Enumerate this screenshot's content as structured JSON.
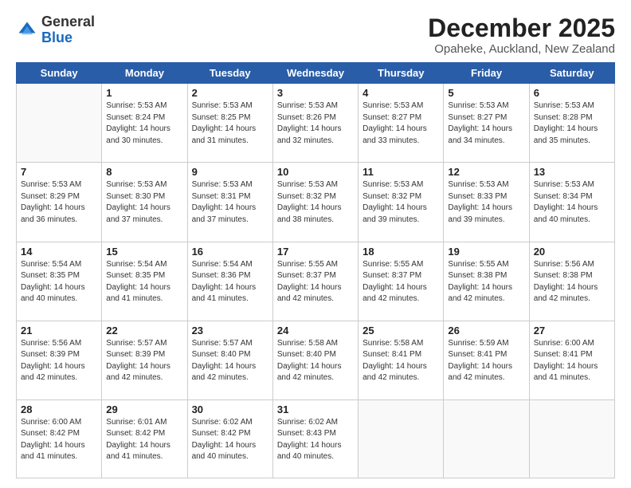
{
  "header": {
    "logo_general": "General",
    "logo_blue": "Blue",
    "month_title": "December 2025",
    "location": "Opaheke, Auckland, New Zealand"
  },
  "days_of_week": [
    "Sunday",
    "Monday",
    "Tuesday",
    "Wednesday",
    "Thursday",
    "Friday",
    "Saturday"
  ],
  "weeks": [
    [
      {
        "day": "",
        "empty": true
      },
      {
        "day": "1",
        "sunrise": "Sunrise: 5:53 AM",
        "sunset": "Sunset: 8:24 PM",
        "daylight": "Daylight: 14 hours and 30 minutes."
      },
      {
        "day": "2",
        "sunrise": "Sunrise: 5:53 AM",
        "sunset": "Sunset: 8:25 PM",
        "daylight": "Daylight: 14 hours and 31 minutes."
      },
      {
        "day": "3",
        "sunrise": "Sunrise: 5:53 AM",
        "sunset": "Sunset: 8:26 PM",
        "daylight": "Daylight: 14 hours and 32 minutes."
      },
      {
        "day": "4",
        "sunrise": "Sunrise: 5:53 AM",
        "sunset": "Sunset: 8:27 PM",
        "daylight": "Daylight: 14 hours and 33 minutes."
      },
      {
        "day": "5",
        "sunrise": "Sunrise: 5:53 AM",
        "sunset": "Sunset: 8:27 PM",
        "daylight": "Daylight: 14 hours and 34 minutes."
      },
      {
        "day": "6",
        "sunrise": "Sunrise: 5:53 AM",
        "sunset": "Sunset: 8:28 PM",
        "daylight": "Daylight: 14 hours and 35 minutes."
      }
    ],
    [
      {
        "day": "7",
        "sunrise": "Sunrise: 5:53 AM",
        "sunset": "Sunset: 8:29 PM",
        "daylight": "Daylight: 14 hours and 36 minutes."
      },
      {
        "day": "8",
        "sunrise": "Sunrise: 5:53 AM",
        "sunset": "Sunset: 8:30 PM",
        "daylight": "Daylight: 14 hours and 37 minutes."
      },
      {
        "day": "9",
        "sunrise": "Sunrise: 5:53 AM",
        "sunset": "Sunset: 8:31 PM",
        "daylight": "Daylight: 14 hours and 37 minutes."
      },
      {
        "day": "10",
        "sunrise": "Sunrise: 5:53 AM",
        "sunset": "Sunset: 8:32 PM",
        "daylight": "Daylight: 14 hours and 38 minutes."
      },
      {
        "day": "11",
        "sunrise": "Sunrise: 5:53 AM",
        "sunset": "Sunset: 8:32 PM",
        "daylight": "Daylight: 14 hours and 39 minutes."
      },
      {
        "day": "12",
        "sunrise": "Sunrise: 5:53 AM",
        "sunset": "Sunset: 8:33 PM",
        "daylight": "Daylight: 14 hours and 39 minutes."
      },
      {
        "day": "13",
        "sunrise": "Sunrise: 5:53 AM",
        "sunset": "Sunset: 8:34 PM",
        "daylight": "Daylight: 14 hours and 40 minutes."
      }
    ],
    [
      {
        "day": "14",
        "sunrise": "Sunrise: 5:54 AM",
        "sunset": "Sunset: 8:35 PM",
        "daylight": "Daylight: 14 hours and 40 minutes."
      },
      {
        "day": "15",
        "sunrise": "Sunrise: 5:54 AM",
        "sunset": "Sunset: 8:35 PM",
        "daylight": "Daylight: 14 hours and 41 minutes."
      },
      {
        "day": "16",
        "sunrise": "Sunrise: 5:54 AM",
        "sunset": "Sunset: 8:36 PM",
        "daylight": "Daylight: 14 hours and 41 minutes."
      },
      {
        "day": "17",
        "sunrise": "Sunrise: 5:55 AM",
        "sunset": "Sunset: 8:37 PM",
        "daylight": "Daylight: 14 hours and 42 minutes."
      },
      {
        "day": "18",
        "sunrise": "Sunrise: 5:55 AM",
        "sunset": "Sunset: 8:37 PM",
        "daylight": "Daylight: 14 hours and 42 minutes."
      },
      {
        "day": "19",
        "sunrise": "Sunrise: 5:55 AM",
        "sunset": "Sunset: 8:38 PM",
        "daylight": "Daylight: 14 hours and 42 minutes."
      },
      {
        "day": "20",
        "sunrise": "Sunrise: 5:56 AM",
        "sunset": "Sunset: 8:38 PM",
        "daylight": "Daylight: 14 hours and 42 minutes."
      }
    ],
    [
      {
        "day": "21",
        "sunrise": "Sunrise: 5:56 AM",
        "sunset": "Sunset: 8:39 PM",
        "daylight": "Daylight: 14 hours and 42 minutes."
      },
      {
        "day": "22",
        "sunrise": "Sunrise: 5:57 AM",
        "sunset": "Sunset: 8:39 PM",
        "daylight": "Daylight: 14 hours and 42 minutes."
      },
      {
        "day": "23",
        "sunrise": "Sunrise: 5:57 AM",
        "sunset": "Sunset: 8:40 PM",
        "daylight": "Daylight: 14 hours and 42 minutes."
      },
      {
        "day": "24",
        "sunrise": "Sunrise: 5:58 AM",
        "sunset": "Sunset: 8:40 PM",
        "daylight": "Daylight: 14 hours and 42 minutes."
      },
      {
        "day": "25",
        "sunrise": "Sunrise: 5:58 AM",
        "sunset": "Sunset: 8:41 PM",
        "daylight": "Daylight: 14 hours and 42 minutes."
      },
      {
        "day": "26",
        "sunrise": "Sunrise: 5:59 AM",
        "sunset": "Sunset: 8:41 PM",
        "daylight": "Daylight: 14 hours and 42 minutes."
      },
      {
        "day": "27",
        "sunrise": "Sunrise: 6:00 AM",
        "sunset": "Sunset: 8:41 PM",
        "daylight": "Daylight: 14 hours and 41 minutes."
      }
    ],
    [
      {
        "day": "28",
        "sunrise": "Sunrise: 6:00 AM",
        "sunset": "Sunset: 8:42 PM",
        "daylight": "Daylight: 14 hours and 41 minutes."
      },
      {
        "day": "29",
        "sunrise": "Sunrise: 6:01 AM",
        "sunset": "Sunset: 8:42 PM",
        "daylight": "Daylight: 14 hours and 41 minutes."
      },
      {
        "day": "30",
        "sunrise": "Sunrise: 6:02 AM",
        "sunset": "Sunset: 8:42 PM",
        "daylight": "Daylight: 14 hours and 40 minutes."
      },
      {
        "day": "31",
        "sunrise": "Sunrise: 6:02 AM",
        "sunset": "Sunset: 8:43 PM",
        "daylight": "Daylight: 14 hours and 40 minutes."
      },
      {
        "day": "",
        "empty": true
      },
      {
        "day": "",
        "empty": true
      },
      {
        "day": "",
        "empty": true
      }
    ]
  ]
}
